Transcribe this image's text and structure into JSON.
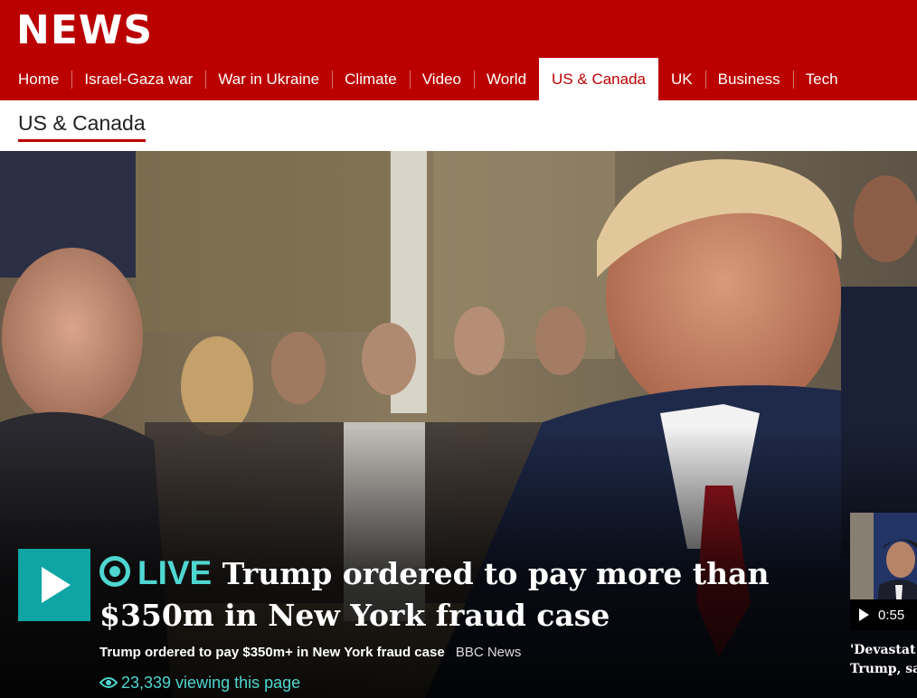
{
  "brand": {
    "logo_text": "NEWS",
    "accent_color": "#bb0000",
    "live_color": "#4fd6d0"
  },
  "nav": {
    "items": [
      {
        "label": "Home"
      },
      {
        "label": "Israel-Gaza war"
      },
      {
        "label": "War in Ukraine"
      },
      {
        "label": "Climate"
      },
      {
        "label": "Video"
      },
      {
        "label": "World"
      },
      {
        "label": "US & Canada",
        "active": true
      },
      {
        "label": "UK"
      },
      {
        "label": "Business"
      },
      {
        "label": "Tech"
      }
    ]
  },
  "section": {
    "title": "US & Canada"
  },
  "hero": {
    "live_label": "LIVE",
    "headline": "Trump ordered to pay more than $350m in New York fraud case",
    "summary": "Trump ordered to pay $350m+ in New York fraud case",
    "source": "BBC News",
    "viewers": "23,339 viewing this page",
    "play_icon": "play-icon"
  },
  "side_video": {
    "duration": "0:55",
    "headline_line1": "'Devastat",
    "headline_line2": "Trump, sa"
  }
}
